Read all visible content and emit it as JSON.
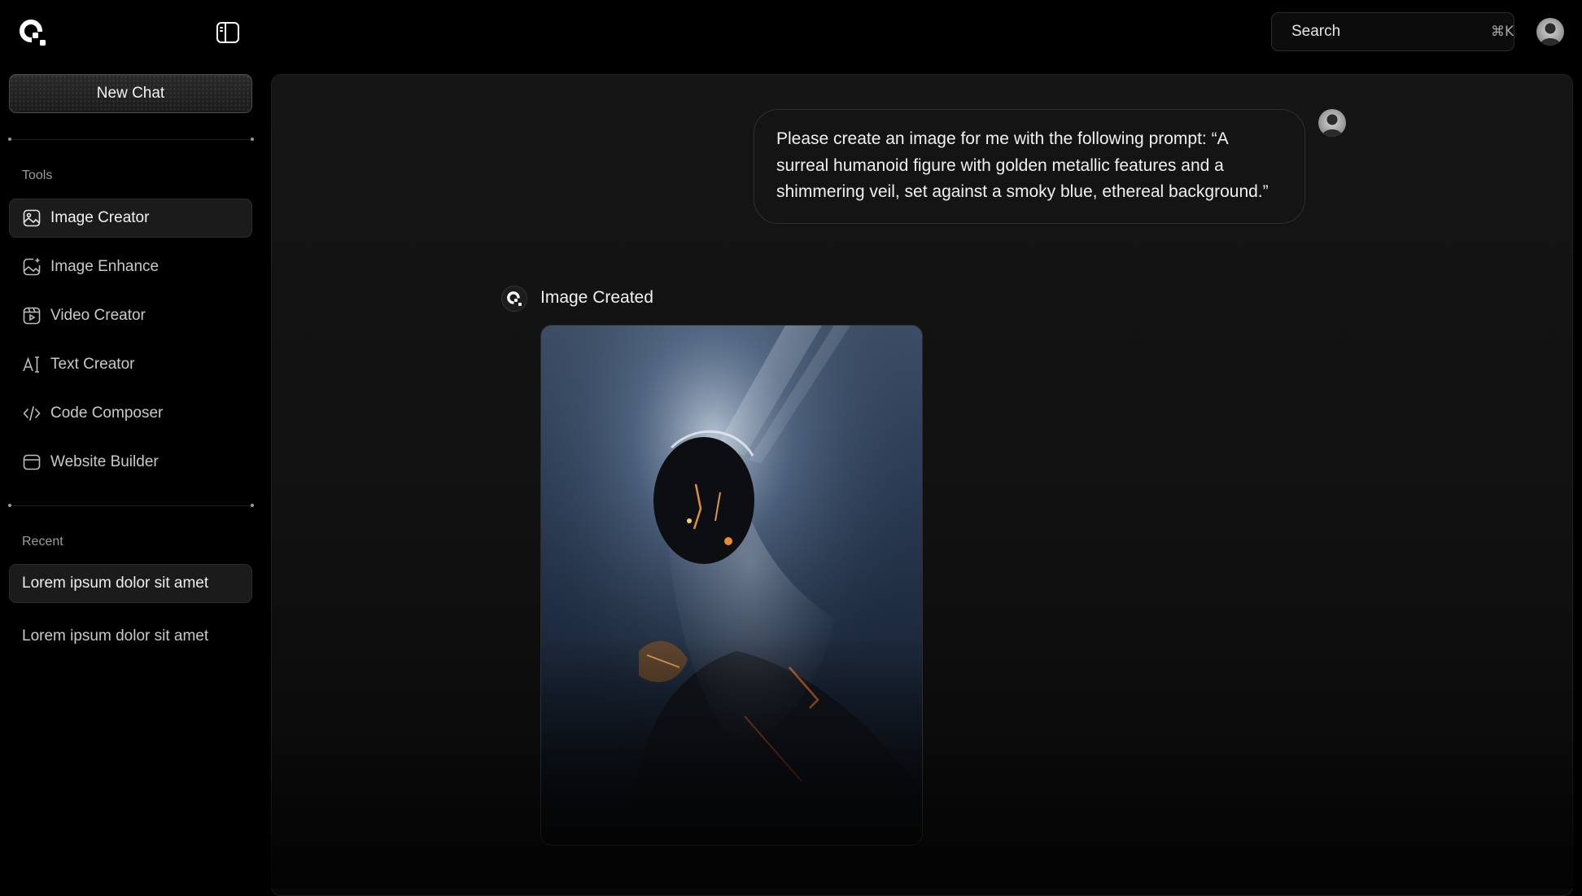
{
  "header": {
    "search": {
      "placeholder": "Search",
      "shortcut": "⌘K"
    }
  },
  "sidebar": {
    "new_chat_label": "New Chat",
    "tools_label": "Tools",
    "tools": [
      {
        "label": "Image Creator",
        "icon": "image-icon",
        "active": true
      },
      {
        "label": "Image Enhance",
        "icon": "image-enhance-icon",
        "active": false
      },
      {
        "label": "Video Creator",
        "icon": "video-icon",
        "active": false
      },
      {
        "label": "Text Creator",
        "icon": "text-cursor-icon",
        "active": false
      },
      {
        "label": "Code Composer",
        "icon": "code-icon",
        "active": false
      },
      {
        "label": "Website Builder",
        "icon": "browser-window-icon",
        "active": false
      }
    ],
    "recent_label": "Recent",
    "recent": [
      {
        "label": "Lorem ipsum dolor sit amet",
        "active": true
      },
      {
        "label": "Lorem ipsum dolor sit amet",
        "active": false
      }
    ]
  },
  "chat": {
    "user_message": "Please create an image for me with the following prompt: “A surreal humanoid figure with golden metallic features and a shimmering veil, set against a smoky blue, ethereal background.”",
    "bot_status": "Image Created"
  },
  "colors": {
    "background": "#000000",
    "panel": "#141414",
    "text": "#f0f0f0",
    "muted": "#9c9c9c"
  }
}
